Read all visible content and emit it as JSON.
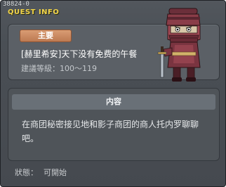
{
  "window": {
    "id_label": "38824-0",
    "title": "QUEST INFO"
  },
  "quest": {
    "tag_label": "主要",
    "name": "[赫里希安]天下没有免费的午餐",
    "level_label": "建議等級：100～119",
    "portrait_icon": "masked-ninja-npc-icon"
  },
  "content": {
    "header": "内容",
    "description": "在商团秘密接见地和影子商团的商人托内罗聊聊吧。"
  },
  "status": {
    "label": "狀態：",
    "value": "可開始"
  },
  "colors": {
    "title": "#f2d54a",
    "tag": "#c98660",
    "panel": "#4a4f55"
  }
}
